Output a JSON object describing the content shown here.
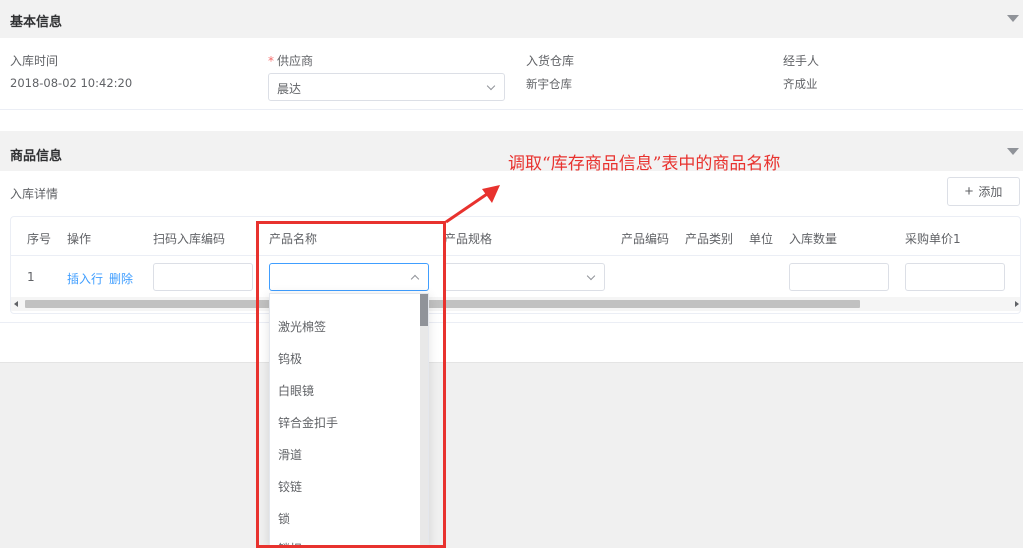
{
  "basic_info": {
    "title": "基本信息",
    "fields": [
      {
        "label": "入库时间",
        "value": "2018-08-02 10:42:20"
      },
      {
        "label": "供应商",
        "required_mark": "*",
        "value": "晨达"
      },
      {
        "label": "入货仓库",
        "value": "新宇仓库"
      },
      {
        "label": "经手人",
        "value": "齐成业"
      }
    ]
  },
  "product_info": {
    "title": "商品信息",
    "subtitle": "入库详情",
    "add_button": "添加",
    "add_icon": "plus-icon"
  },
  "table": {
    "headers": [
      "序号",
      "操作",
      "扫码入库编码",
      "产品名称",
      "产品规格",
      "产品编码",
      "产品类别",
      "单位",
      "入库数量",
      "采购单价1"
    ],
    "rows": [
      {
        "index": "1",
        "action_insert": "插入行",
        "action_delete": "删除"
      }
    ]
  },
  "dropdown": {
    "options": [
      "激光棉签",
      "钨极",
      "白眼镜",
      "锌合金扣手",
      "滑道",
      "铰链",
      "锁",
      "锁扣"
    ]
  },
  "annotation": {
    "text": "调取“库存商品信息”表中的商品名称",
    "color": "#e8322e"
  },
  "colors": {
    "accent": "#409eff",
    "header_bg": "#f2f2f2",
    "annotation_red": "#e8322e"
  }
}
